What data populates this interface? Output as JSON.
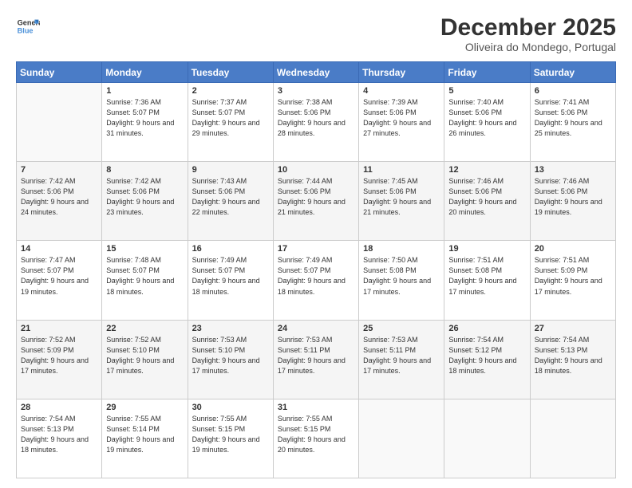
{
  "header": {
    "logo_general": "General",
    "logo_blue": "Blue",
    "month_title": "December 2025",
    "subtitle": "Oliveira do Mondego, Portugal"
  },
  "weekdays": [
    "Sunday",
    "Monday",
    "Tuesday",
    "Wednesday",
    "Thursday",
    "Friday",
    "Saturday"
  ],
  "weeks": [
    [
      {
        "day": "",
        "sunrise": "",
        "sunset": "",
        "daylight": ""
      },
      {
        "day": "1",
        "sunrise": "Sunrise: 7:36 AM",
        "sunset": "Sunset: 5:07 PM",
        "daylight": "Daylight: 9 hours and 31 minutes."
      },
      {
        "day": "2",
        "sunrise": "Sunrise: 7:37 AM",
        "sunset": "Sunset: 5:07 PM",
        "daylight": "Daylight: 9 hours and 29 minutes."
      },
      {
        "day": "3",
        "sunrise": "Sunrise: 7:38 AM",
        "sunset": "Sunset: 5:06 PM",
        "daylight": "Daylight: 9 hours and 28 minutes."
      },
      {
        "day": "4",
        "sunrise": "Sunrise: 7:39 AM",
        "sunset": "Sunset: 5:06 PM",
        "daylight": "Daylight: 9 hours and 27 minutes."
      },
      {
        "day": "5",
        "sunrise": "Sunrise: 7:40 AM",
        "sunset": "Sunset: 5:06 PM",
        "daylight": "Daylight: 9 hours and 26 minutes."
      },
      {
        "day": "6",
        "sunrise": "Sunrise: 7:41 AM",
        "sunset": "Sunset: 5:06 PM",
        "daylight": "Daylight: 9 hours and 25 minutes."
      }
    ],
    [
      {
        "day": "7",
        "sunrise": "Sunrise: 7:42 AM",
        "sunset": "Sunset: 5:06 PM",
        "daylight": "Daylight: 9 hours and 24 minutes."
      },
      {
        "day": "8",
        "sunrise": "Sunrise: 7:42 AM",
        "sunset": "Sunset: 5:06 PM",
        "daylight": "Daylight: 9 hours and 23 minutes."
      },
      {
        "day": "9",
        "sunrise": "Sunrise: 7:43 AM",
        "sunset": "Sunset: 5:06 PM",
        "daylight": "Daylight: 9 hours and 22 minutes."
      },
      {
        "day": "10",
        "sunrise": "Sunrise: 7:44 AM",
        "sunset": "Sunset: 5:06 PM",
        "daylight": "Daylight: 9 hours and 21 minutes."
      },
      {
        "day": "11",
        "sunrise": "Sunrise: 7:45 AM",
        "sunset": "Sunset: 5:06 PM",
        "daylight": "Daylight: 9 hours and 21 minutes."
      },
      {
        "day": "12",
        "sunrise": "Sunrise: 7:46 AM",
        "sunset": "Sunset: 5:06 PM",
        "daylight": "Daylight: 9 hours and 20 minutes."
      },
      {
        "day": "13",
        "sunrise": "Sunrise: 7:46 AM",
        "sunset": "Sunset: 5:06 PM",
        "daylight": "Daylight: 9 hours and 19 minutes."
      }
    ],
    [
      {
        "day": "14",
        "sunrise": "Sunrise: 7:47 AM",
        "sunset": "Sunset: 5:07 PM",
        "daylight": "Daylight: 9 hours and 19 minutes."
      },
      {
        "day": "15",
        "sunrise": "Sunrise: 7:48 AM",
        "sunset": "Sunset: 5:07 PM",
        "daylight": "Daylight: 9 hours and 18 minutes."
      },
      {
        "day": "16",
        "sunrise": "Sunrise: 7:49 AM",
        "sunset": "Sunset: 5:07 PM",
        "daylight": "Daylight: 9 hours and 18 minutes."
      },
      {
        "day": "17",
        "sunrise": "Sunrise: 7:49 AM",
        "sunset": "Sunset: 5:07 PM",
        "daylight": "Daylight: 9 hours and 18 minutes."
      },
      {
        "day": "18",
        "sunrise": "Sunrise: 7:50 AM",
        "sunset": "Sunset: 5:08 PM",
        "daylight": "Daylight: 9 hours and 17 minutes."
      },
      {
        "day": "19",
        "sunrise": "Sunrise: 7:51 AM",
        "sunset": "Sunset: 5:08 PM",
        "daylight": "Daylight: 9 hours and 17 minutes."
      },
      {
        "day": "20",
        "sunrise": "Sunrise: 7:51 AM",
        "sunset": "Sunset: 5:09 PM",
        "daylight": "Daylight: 9 hours and 17 minutes."
      }
    ],
    [
      {
        "day": "21",
        "sunrise": "Sunrise: 7:52 AM",
        "sunset": "Sunset: 5:09 PM",
        "daylight": "Daylight: 9 hours and 17 minutes."
      },
      {
        "day": "22",
        "sunrise": "Sunrise: 7:52 AM",
        "sunset": "Sunset: 5:10 PM",
        "daylight": "Daylight: 9 hours and 17 minutes."
      },
      {
        "day": "23",
        "sunrise": "Sunrise: 7:53 AM",
        "sunset": "Sunset: 5:10 PM",
        "daylight": "Daylight: 9 hours and 17 minutes."
      },
      {
        "day": "24",
        "sunrise": "Sunrise: 7:53 AM",
        "sunset": "Sunset: 5:11 PM",
        "daylight": "Daylight: 9 hours and 17 minutes."
      },
      {
        "day": "25",
        "sunrise": "Sunrise: 7:53 AM",
        "sunset": "Sunset: 5:11 PM",
        "daylight": "Daylight: 9 hours and 17 minutes."
      },
      {
        "day": "26",
        "sunrise": "Sunrise: 7:54 AM",
        "sunset": "Sunset: 5:12 PM",
        "daylight": "Daylight: 9 hours and 18 minutes."
      },
      {
        "day": "27",
        "sunrise": "Sunrise: 7:54 AM",
        "sunset": "Sunset: 5:13 PM",
        "daylight": "Daylight: 9 hours and 18 minutes."
      }
    ],
    [
      {
        "day": "28",
        "sunrise": "Sunrise: 7:54 AM",
        "sunset": "Sunset: 5:13 PM",
        "daylight": "Daylight: 9 hours and 18 minutes."
      },
      {
        "day": "29",
        "sunrise": "Sunrise: 7:55 AM",
        "sunset": "Sunset: 5:14 PM",
        "daylight": "Daylight: 9 hours and 19 minutes."
      },
      {
        "day": "30",
        "sunrise": "Sunrise: 7:55 AM",
        "sunset": "Sunset: 5:15 PM",
        "daylight": "Daylight: 9 hours and 19 minutes."
      },
      {
        "day": "31",
        "sunrise": "Sunrise: 7:55 AM",
        "sunset": "Sunset: 5:15 PM",
        "daylight": "Daylight: 9 hours and 20 minutes."
      },
      {
        "day": "",
        "sunrise": "",
        "sunset": "",
        "daylight": ""
      },
      {
        "day": "",
        "sunrise": "",
        "sunset": "",
        "daylight": ""
      },
      {
        "day": "",
        "sunrise": "",
        "sunset": "",
        "daylight": ""
      }
    ]
  ]
}
